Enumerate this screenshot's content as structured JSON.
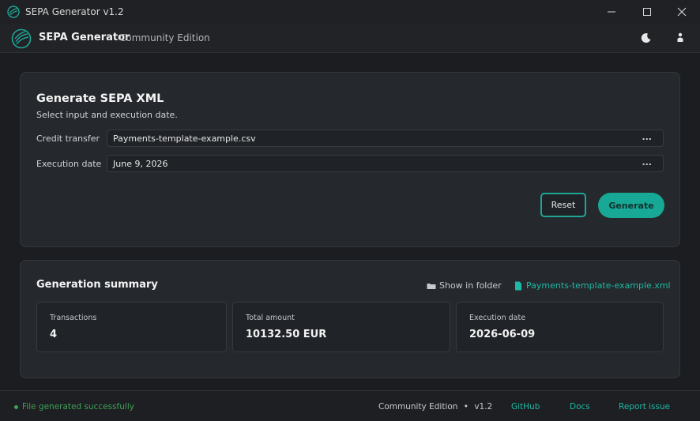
{
  "window": {
    "title": "SEPA Generator v1.2"
  },
  "header": {
    "brand": "SEPA Generator",
    "edition": "Community Edition"
  },
  "generate": {
    "title": "Generate SEPA XML",
    "subtitle": "Select input and execution date.",
    "credit_label": "Credit transfer",
    "credit_value": "Payments-template-example.csv",
    "date_label": "Execution date",
    "date_value": "June 9, 2026",
    "browse": "...",
    "reset": "Reset",
    "generate": "Generate"
  },
  "summary": {
    "title": "Generation summary",
    "show_folder": "Show in folder",
    "file_link": "Payments-template-example.xml",
    "stats": [
      {
        "label": "Transactions",
        "value": "4"
      },
      {
        "label": "Total amount",
        "value": "10132.50 EUR"
      },
      {
        "label": "Execution date",
        "value": "2026-06-09"
      }
    ]
  },
  "footer": {
    "status": "File generated successfully",
    "edition": "Community Edition",
    "separator": "•",
    "version": "v1.2",
    "links": [
      "GitHub",
      "Docs",
      "Report issue"
    ]
  },
  "colors": {
    "accent": "#18a896",
    "success": "#3fa155",
    "background": "#1b1d20"
  }
}
